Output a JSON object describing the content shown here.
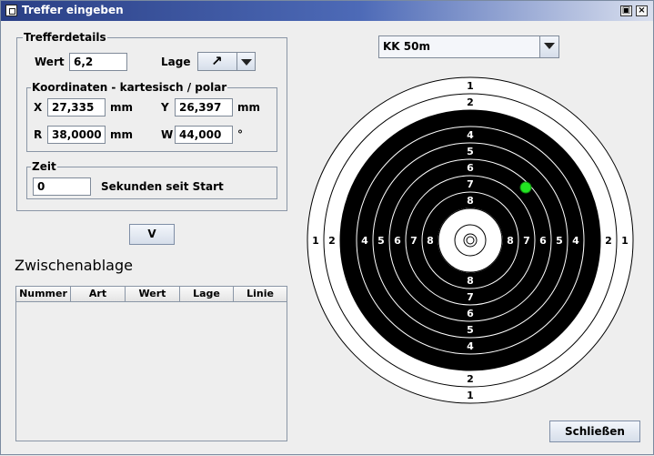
{
  "window": {
    "title": "Treffer eingeben"
  },
  "trefferdetails": {
    "legend": "Trefferdetails",
    "wert_label": "Wert",
    "wert_value": "6,2",
    "lage_label": "Lage",
    "lage_value": "↗"
  },
  "koordinaten": {
    "legend": "Koordinaten - kartesisch / polar",
    "x_label": "X",
    "x_value": "27,335",
    "x_unit": "mm",
    "y_label": "Y",
    "y_value": "26,397",
    "y_unit": "mm",
    "r_label": "R",
    "r_value": "38,0000",
    "r_unit": "mm",
    "w_label": "W",
    "w_value": "44,000",
    "w_unit": "°"
  },
  "zeit": {
    "legend": "Zeit",
    "value": "0",
    "suffix": "Sekunden seit Start"
  },
  "v_button": "V",
  "zwischenablage": {
    "title": "Zwischenablage",
    "columns": [
      "Nummer",
      "Art",
      "Wert",
      "Lage",
      "Linie"
    ]
  },
  "target": {
    "discipline": "KK 50m",
    "ring_numbers": [
      "1",
      "2",
      "3",
      "4",
      "5",
      "6",
      "7",
      "8"
    ],
    "hit_color": "#22e422"
  },
  "close_button": "Schließen"
}
